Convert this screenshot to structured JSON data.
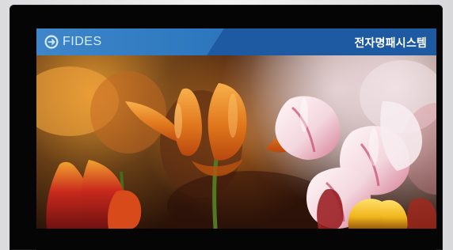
{
  "header": {
    "logo_text": "FIDES",
    "title": "전자명패시스템"
  },
  "icons": {
    "logo": "fides-logo-icon"
  },
  "colors": {
    "banner_blue": "#2f79c0",
    "banner_dark_blue": "#1e5aa1",
    "bezel": "#050505",
    "title_text": "#ffffff"
  }
}
